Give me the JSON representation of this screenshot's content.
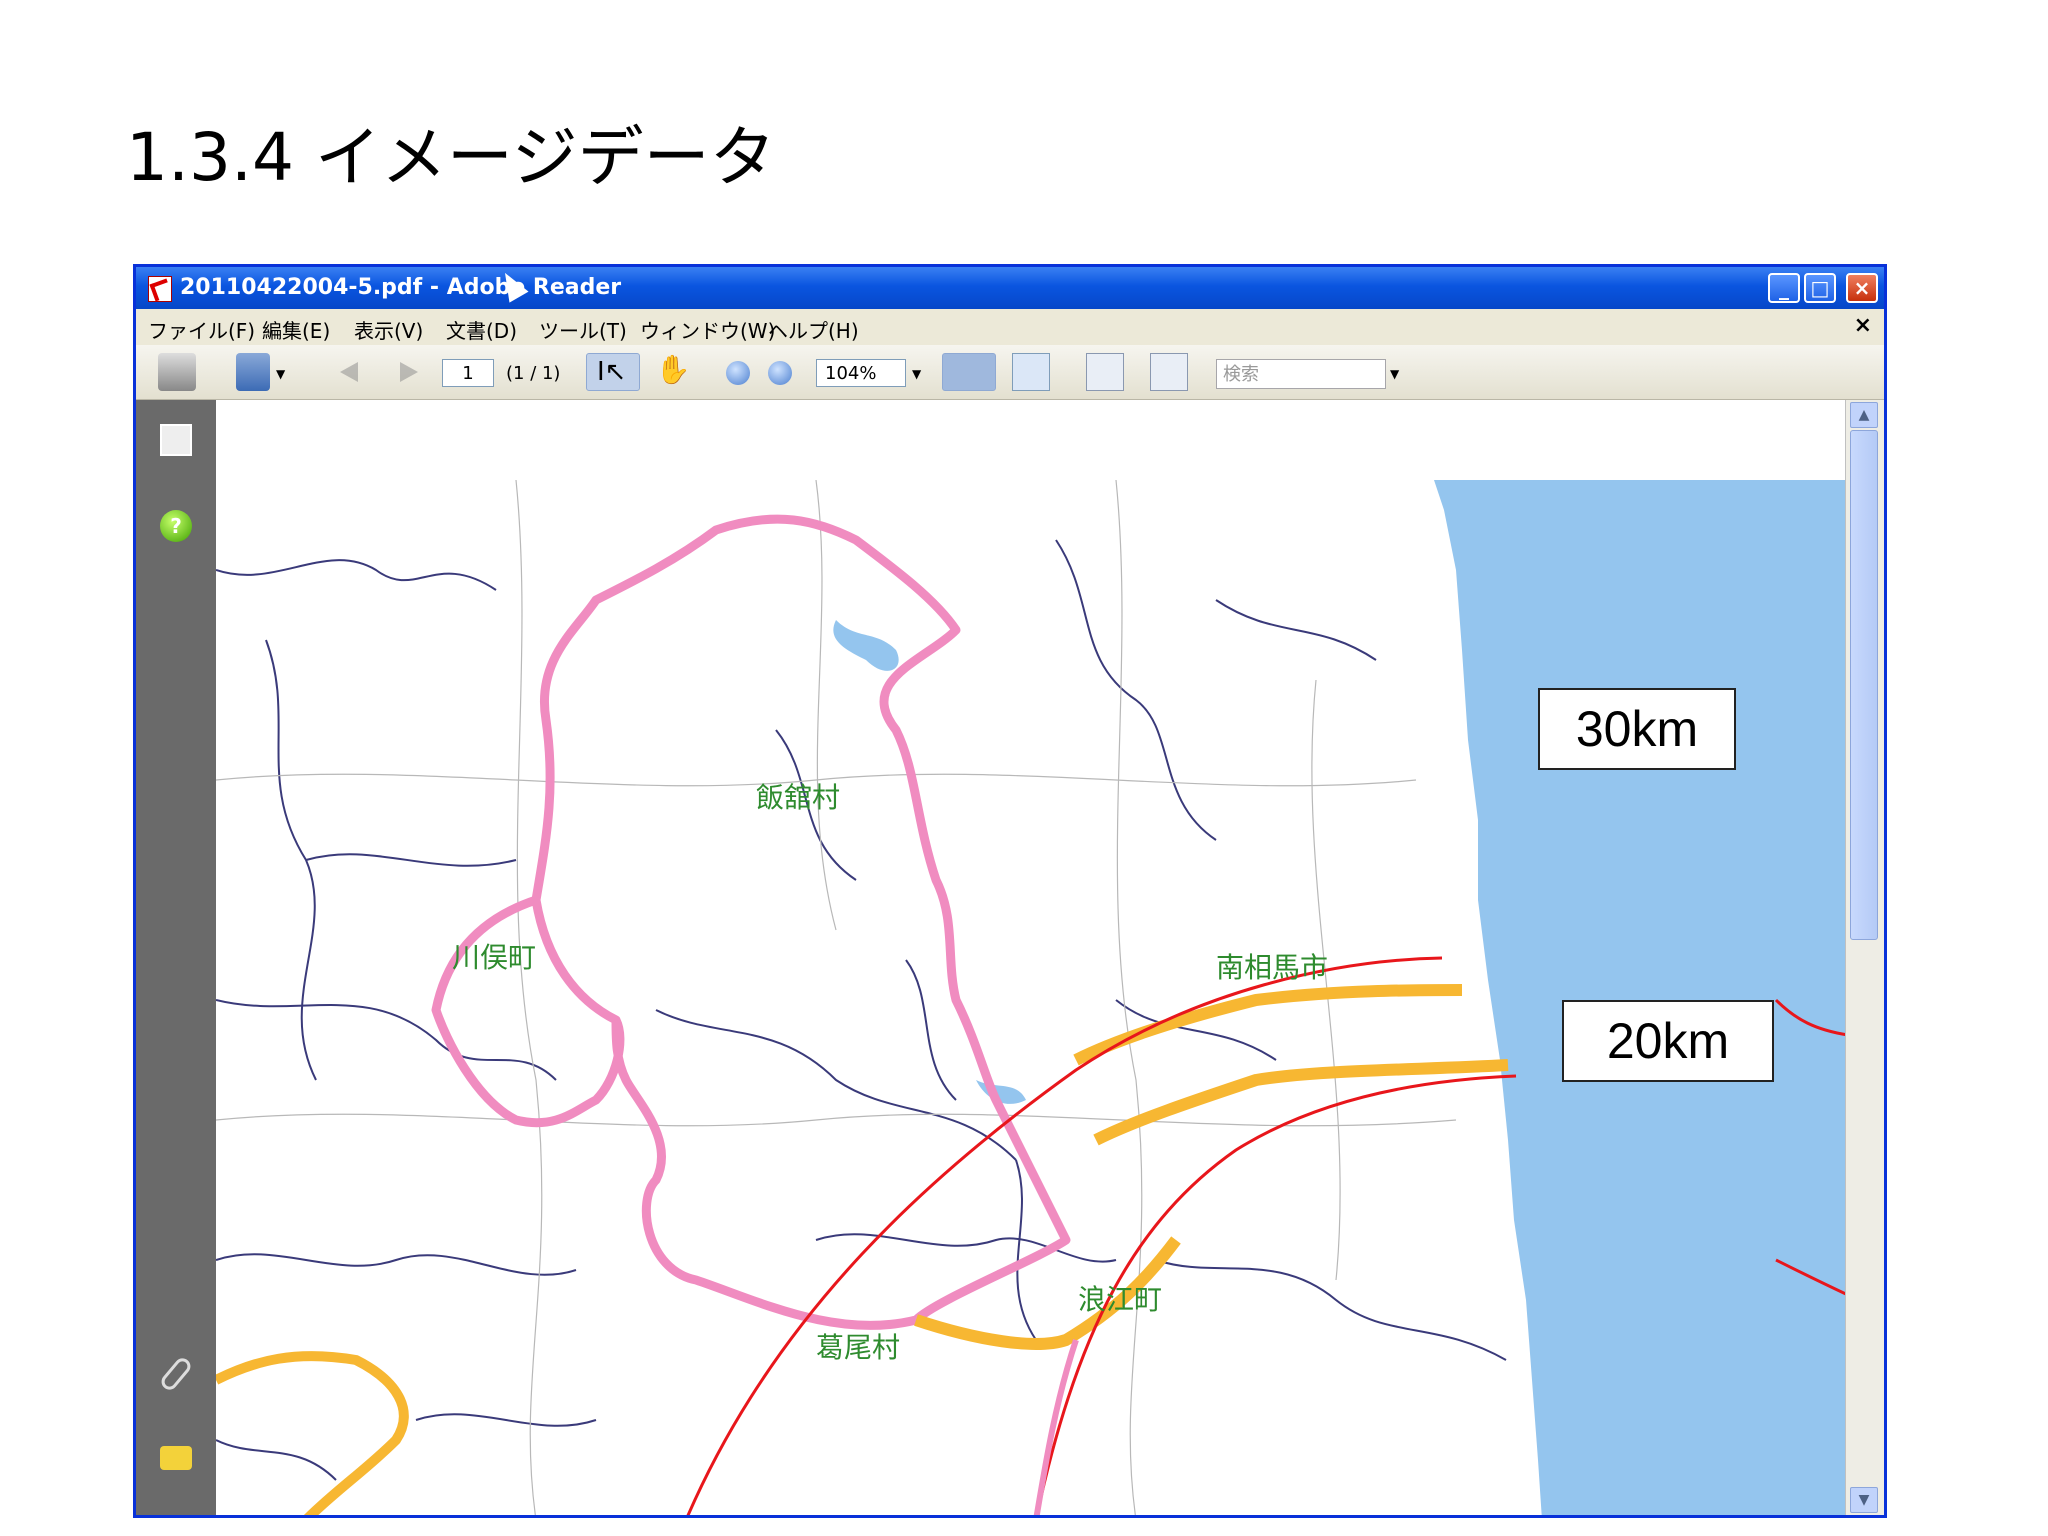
{
  "heading": "1.3.4 イメージデータ",
  "window": {
    "title": "20110422004-5.pdf - Adobe Reader",
    "menu": [
      "ファイル(F)",
      "編集(E)",
      "表示(V)",
      "文書(D)",
      "ツール(T)",
      "ウィンドウ(W)",
      "ヘルプ(H)"
    ],
    "menu_close": "×"
  },
  "toolbar": {
    "page_value": "1",
    "page_count": "(1 / 1)",
    "zoom_value": "104%",
    "search_placeholder": "検索"
  },
  "map": {
    "labels": {
      "ring_30": "30km",
      "ring_20": "20km",
      "iitate": "飯舘村",
      "kawamata": "川俣町",
      "minamisoma": "南相馬市",
      "namie": "浪江町",
      "katsurao": "葛尾村"
    },
    "colors": {
      "sea": "#94c5ee",
      "pink_boundary": "#f08cc0",
      "orange_boundary": "#f7b732",
      "ring_line": "#e8161b"
    }
  },
  "icons": {
    "window": "pdf-icon",
    "help": "help-icon",
    "attachments": "paperclip-icon",
    "comments": "comment-icon"
  }
}
